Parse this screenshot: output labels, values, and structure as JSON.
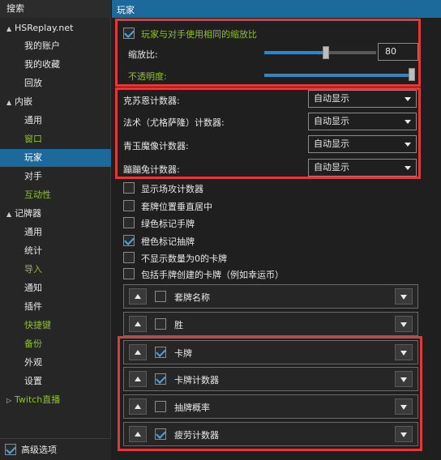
{
  "sidebar": {
    "items": [
      {
        "label": "搜索",
        "level": 0,
        "style": "header"
      },
      {
        "label": "HSReplay.net",
        "level": 0,
        "expander": "▲"
      },
      {
        "label": "我的账户",
        "level": 1
      },
      {
        "label": "我的收藏",
        "level": 1
      },
      {
        "label": "回放",
        "level": 1
      },
      {
        "label": "内嵌",
        "level": 0,
        "expander": "▲"
      },
      {
        "label": "通用",
        "level": 1
      },
      {
        "label": "窗口",
        "level": 1,
        "color": "green"
      },
      {
        "label": "玩家",
        "level": 1,
        "selected": true
      },
      {
        "label": "对手",
        "level": 1
      },
      {
        "label": "互动性",
        "level": 1,
        "color": "green"
      },
      {
        "label": "记牌器",
        "level": 0,
        "expander": "▲"
      },
      {
        "label": "通用",
        "level": 1
      },
      {
        "label": "统计",
        "level": 1
      },
      {
        "label": "导入",
        "level": 1,
        "color": "green"
      },
      {
        "label": "通知",
        "level": 1
      },
      {
        "label": "插件",
        "level": 1
      },
      {
        "label": "快捷键",
        "level": 1,
        "color": "green"
      },
      {
        "label": "备份",
        "level": 1,
        "color": "green"
      },
      {
        "label": "外观",
        "level": 1
      },
      {
        "label": "设置",
        "level": 1
      },
      {
        "label": "Twitch直播",
        "level": 0,
        "expander": "▷",
        "color": "green"
      }
    ],
    "footer": {
      "label": "高级选项",
      "checked": true
    }
  },
  "main": {
    "title": "玩家",
    "same_scale": {
      "label": "玩家与对手使用相同的缩放比",
      "checked": true
    },
    "scale": {
      "label": "缩放比:",
      "value": "80",
      "fraction": 0.55
    },
    "opacity": {
      "label": "不透明度:",
      "fraction": 1.0
    },
    "counters": [
      {
        "label": "克苏恩计数器:",
        "value": "自动显示"
      },
      {
        "label": "法术（尤格萨隆）计数器:",
        "value": "自动显示"
      },
      {
        "label": "青玉魔像计数器:",
        "value": "自动显示"
      },
      {
        "label": "蹦蹦兔计数器:",
        "value": "自动显示"
      }
    ],
    "options": [
      {
        "label": "显示场攻计数器",
        "checked": false
      },
      {
        "label": "套牌位置垂直居中",
        "checked": false
      },
      {
        "label": "绿色标记手牌",
        "checked": false
      },
      {
        "label": "橙色标记抽牌",
        "checked": true
      },
      {
        "label": "不显示数量为0的卡牌",
        "checked": false
      },
      {
        "label": "包括手牌创建的卡牌（例如幸运币）",
        "checked": false
      }
    ],
    "panels": [
      {
        "label": "套牌名称",
        "checked": false
      },
      {
        "label": "胜",
        "checked": false
      },
      {
        "label": "卡牌",
        "checked": true
      },
      {
        "label": "卡牌计数器",
        "checked": true
      },
      {
        "label": "抽牌概率",
        "checked": false
      },
      {
        "label": "疲劳计数器",
        "checked": true
      }
    ]
  },
  "colors": {
    "accent": "#1c6a9c",
    "green_text": "#8fc02c",
    "highlight_box": "#e0393b",
    "background": "#1f1f1f"
  }
}
